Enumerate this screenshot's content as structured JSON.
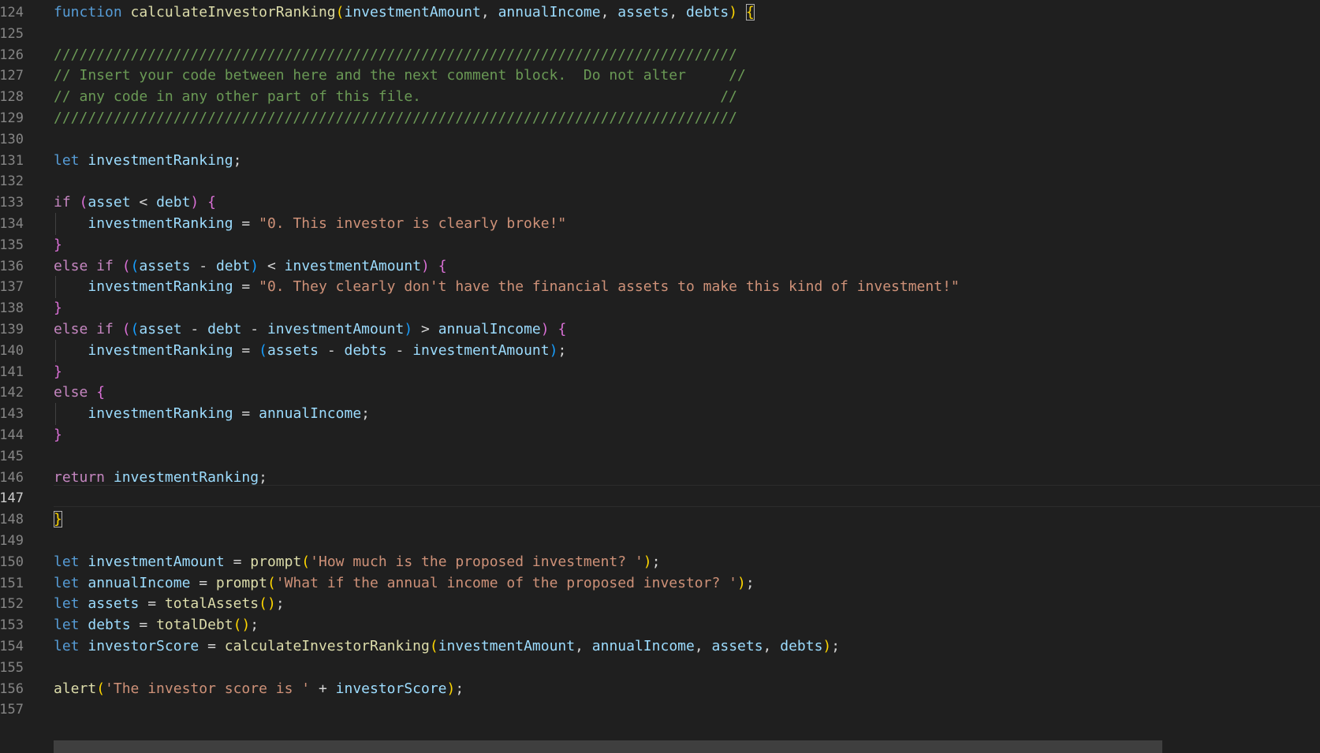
{
  "editor": {
    "lines": [
      {
        "n": "124",
        "segs": [
          [
            "kw",
            "function "
          ],
          [
            "fn",
            "calculateInvestorRanking"
          ],
          [
            "p1",
            "("
          ],
          [
            "var",
            "investmentAmount"
          ],
          [
            "op",
            ", "
          ],
          [
            "var",
            "annualIncome"
          ],
          [
            "op",
            ", "
          ],
          [
            "var",
            "assets"
          ],
          [
            "op",
            ", "
          ],
          [
            "var",
            "debts"
          ],
          [
            "p1",
            ")"
          ],
          [
            "op",
            " "
          ],
          [
            "p1 bm",
            "{"
          ]
        ]
      },
      {
        "n": "125",
        "segs": []
      },
      {
        "n": "126",
        "segs": [
          [
            "cmt",
            "////////////////////////////////////////////////////////////////////////////////"
          ]
        ]
      },
      {
        "n": "127",
        "segs": [
          [
            "cmt",
            "// Insert your code between here and the next comment block.  Do not alter     //"
          ]
        ]
      },
      {
        "n": "128",
        "segs": [
          [
            "cmt",
            "// any code in any other part of this file.                                   //"
          ]
        ]
      },
      {
        "n": "129",
        "segs": [
          [
            "cmt",
            "////////////////////////////////////////////////////////////////////////////////"
          ]
        ]
      },
      {
        "n": "130",
        "segs": []
      },
      {
        "n": "131",
        "segs": [
          [
            "kw",
            "let "
          ],
          [
            "var",
            "investmentRanking"
          ],
          [
            "op",
            ";"
          ]
        ]
      },
      {
        "n": "132",
        "segs": []
      },
      {
        "n": "133",
        "segs": [
          [
            "ctl",
            "if "
          ],
          [
            "p2",
            "("
          ],
          [
            "var",
            "asset"
          ],
          [
            "op",
            " < "
          ],
          [
            "var",
            "debt"
          ],
          [
            "p2",
            ")"
          ],
          [
            "op",
            " "
          ],
          [
            "p2",
            "{"
          ]
        ]
      },
      {
        "n": "134",
        "guide": true,
        "segs": [
          [
            "op",
            "    "
          ],
          [
            "var",
            "investmentRanking"
          ],
          [
            "op",
            " = "
          ],
          [
            "str",
            "\"0. This investor is clearly broke!\""
          ]
        ]
      },
      {
        "n": "135",
        "segs": [
          [
            "p2",
            "}"
          ]
        ]
      },
      {
        "n": "136",
        "segs": [
          [
            "ctl",
            "else if "
          ],
          [
            "p2",
            "("
          ],
          [
            "p3",
            "("
          ],
          [
            "var",
            "assets"
          ],
          [
            "op",
            " - "
          ],
          [
            "var",
            "debt"
          ],
          [
            "p3",
            ")"
          ],
          [
            "op",
            " < "
          ],
          [
            "var",
            "investmentAmount"
          ],
          [
            "p2",
            ")"
          ],
          [
            "op",
            " "
          ],
          [
            "p2",
            "{"
          ]
        ]
      },
      {
        "n": "137",
        "guide": true,
        "segs": [
          [
            "op",
            "    "
          ],
          [
            "var",
            "investmentRanking"
          ],
          [
            "op",
            " = "
          ],
          [
            "str",
            "\"0. They clearly don't have the financial assets to make this kind of investment!\""
          ]
        ]
      },
      {
        "n": "138",
        "segs": [
          [
            "p2",
            "}"
          ]
        ]
      },
      {
        "n": "139",
        "segs": [
          [
            "ctl",
            "else if "
          ],
          [
            "p2",
            "("
          ],
          [
            "p3",
            "("
          ],
          [
            "var",
            "asset"
          ],
          [
            "op",
            " - "
          ],
          [
            "var",
            "debt"
          ],
          [
            "op",
            " - "
          ],
          [
            "var",
            "investmentAmount"
          ],
          [
            "p3",
            ")"
          ],
          [
            "op",
            " > "
          ],
          [
            "var",
            "annualIncome"
          ],
          [
            "p2",
            ")"
          ],
          [
            "op",
            " "
          ],
          [
            "p2",
            "{"
          ]
        ]
      },
      {
        "n": "140",
        "guide": true,
        "segs": [
          [
            "op",
            "    "
          ],
          [
            "var",
            "investmentRanking"
          ],
          [
            "op",
            " = "
          ],
          [
            "p3",
            "("
          ],
          [
            "var",
            "assets"
          ],
          [
            "op",
            " - "
          ],
          [
            "var",
            "debts"
          ],
          [
            "op",
            " - "
          ],
          [
            "var",
            "investmentAmount"
          ],
          [
            "p3",
            ")"
          ],
          [
            "op",
            ";"
          ]
        ]
      },
      {
        "n": "141",
        "segs": [
          [
            "p2",
            "}"
          ]
        ]
      },
      {
        "n": "142",
        "segs": [
          [
            "ctl",
            "else "
          ],
          [
            "p2",
            "{"
          ]
        ]
      },
      {
        "n": "143",
        "guide": true,
        "segs": [
          [
            "op",
            "    "
          ],
          [
            "var",
            "investmentRanking"
          ],
          [
            "op",
            " = "
          ],
          [
            "var",
            "annualIncome"
          ],
          [
            "op",
            ";"
          ]
        ]
      },
      {
        "n": "144",
        "segs": [
          [
            "p2",
            "}"
          ]
        ]
      },
      {
        "n": "145",
        "segs": []
      },
      {
        "n": "146",
        "segs": [
          [
            "ctl",
            "return "
          ],
          [
            "var",
            "investmentRanking"
          ],
          [
            "op",
            ";"
          ]
        ]
      },
      {
        "n": "147",
        "active": true,
        "segs": []
      },
      {
        "n": "148",
        "segs": [
          [
            "p1 bm",
            "}"
          ]
        ]
      },
      {
        "n": "149",
        "segs": []
      },
      {
        "n": "150",
        "segs": [
          [
            "kw",
            "let "
          ],
          [
            "var",
            "investmentAmount"
          ],
          [
            "op",
            " = "
          ],
          [
            "fn",
            "prompt"
          ],
          [
            "p1",
            "("
          ],
          [
            "str",
            "'How much is the proposed investment? '"
          ],
          [
            "p1",
            ")"
          ],
          [
            "op",
            ";"
          ]
        ]
      },
      {
        "n": "151",
        "segs": [
          [
            "kw",
            "let "
          ],
          [
            "var",
            "annualIncome"
          ],
          [
            "op",
            " = "
          ],
          [
            "fn",
            "prompt"
          ],
          [
            "p1",
            "("
          ],
          [
            "str",
            "'What if the annual income of the proposed investor? '"
          ],
          [
            "p1",
            ")"
          ],
          [
            "op",
            ";"
          ]
        ]
      },
      {
        "n": "152",
        "segs": [
          [
            "kw",
            "let "
          ],
          [
            "var",
            "assets"
          ],
          [
            "op",
            " = "
          ],
          [
            "fn",
            "totalAssets"
          ],
          [
            "p1",
            "()"
          ],
          [
            "op",
            ";"
          ]
        ]
      },
      {
        "n": "153",
        "segs": [
          [
            "kw",
            "let "
          ],
          [
            "var",
            "debts"
          ],
          [
            "op",
            " = "
          ],
          [
            "fn",
            "totalDebt"
          ],
          [
            "p1",
            "()"
          ],
          [
            "op",
            ";"
          ]
        ]
      },
      {
        "n": "154",
        "segs": [
          [
            "kw",
            "let "
          ],
          [
            "var",
            "investorScore"
          ],
          [
            "op",
            " = "
          ],
          [
            "fn",
            "calculateInvestorRanking"
          ],
          [
            "p1",
            "("
          ],
          [
            "var",
            "investmentAmount"
          ],
          [
            "op",
            ", "
          ],
          [
            "var",
            "annualIncome"
          ],
          [
            "op",
            ", "
          ],
          [
            "var",
            "assets"
          ],
          [
            "op",
            ", "
          ],
          [
            "var",
            "debts"
          ],
          [
            "p1",
            ")"
          ],
          [
            "op",
            ";"
          ]
        ]
      },
      {
        "n": "155",
        "segs": []
      },
      {
        "n": "156",
        "segs": [
          [
            "fn",
            "alert"
          ],
          [
            "p1",
            "("
          ],
          [
            "str",
            "'The investor score is '"
          ],
          [
            "op",
            " + "
          ],
          [
            "var",
            "investorScore"
          ],
          [
            "p1",
            ")"
          ],
          [
            "op",
            ";"
          ]
        ]
      },
      {
        "n": "157",
        "segs": []
      }
    ]
  }
}
